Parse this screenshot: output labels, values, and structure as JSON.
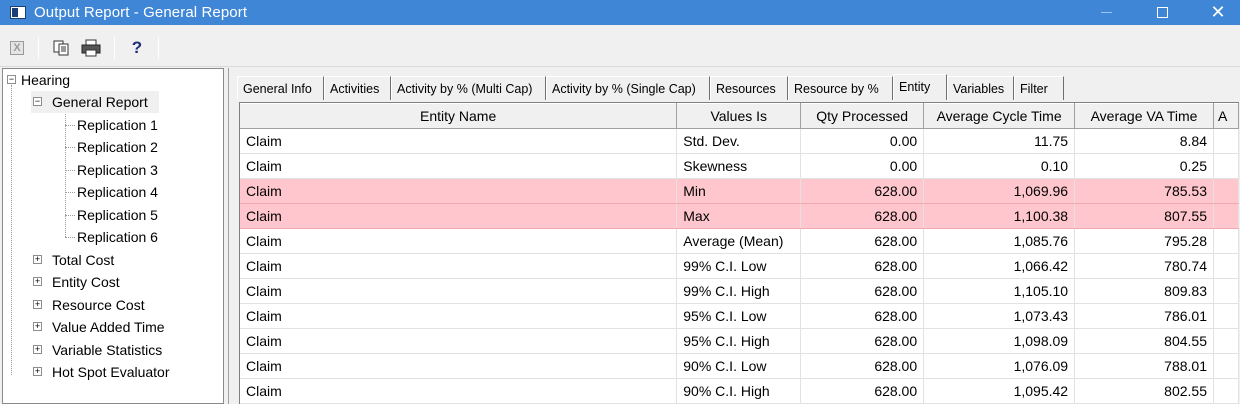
{
  "window": {
    "title": "Output Report - General Report",
    "controls": {
      "minimize": "—",
      "maximize": "☐",
      "close": "✕"
    }
  },
  "toolbar": {
    "excel_icon_text": "X",
    "copy_icon": "copy-icon",
    "print_icon": "print-icon",
    "help_label": "?"
  },
  "tree": {
    "root": "Hearing",
    "general_report": "General Report",
    "replications": [
      "Replication 1",
      "Replication 2",
      "Replication 3",
      "Replication 4",
      "Replication 5",
      "Replication 6"
    ],
    "categories": [
      "Total Cost",
      "Entity Cost",
      "Resource Cost",
      "Value Added Time",
      "Variable Statistics",
      "Hot Spot Evaluator"
    ]
  },
  "tabs": [
    {
      "label": "General Info"
    },
    {
      "label": "Activities"
    },
    {
      "label": "Activity by % (Multi Cap)"
    },
    {
      "label": "Activity by % (Single Cap)"
    },
    {
      "label": "Resources"
    },
    {
      "label": "Resource by %"
    },
    {
      "label": "Entity",
      "active": true
    },
    {
      "label": "Variables"
    },
    {
      "label": "Filter"
    }
  ],
  "grid": {
    "columns": [
      "Entity Name",
      "Values Is",
      "Qty Processed",
      "Average Cycle Time",
      "Average VA Time",
      "A"
    ],
    "rows": [
      {
        "entity": "Claim",
        "values_is": "Std. Dev.",
        "qty": "0.00",
        "cycle": "11.75",
        "va": "8.84",
        "highlight": false
      },
      {
        "entity": "Claim",
        "values_is": "Skewness",
        "qty": "0.00",
        "cycle": "0.10",
        "va": "0.25",
        "highlight": false
      },
      {
        "entity": "Claim",
        "values_is": "Min",
        "qty": "628.00",
        "cycle": "1,069.96",
        "va": "785.53",
        "highlight": true
      },
      {
        "entity": "Claim",
        "values_is": "Max",
        "qty": "628.00",
        "cycle": "1,100.38",
        "va": "807.55",
        "highlight": true
      },
      {
        "entity": "Claim",
        "values_is": "Average (Mean)",
        "qty": "628.00",
        "cycle": "1,085.76",
        "va": "795.28",
        "highlight": false
      },
      {
        "entity": "Claim",
        "values_is": "99% C.I. Low",
        "qty": "628.00",
        "cycle": "1,066.42",
        "va": "780.74",
        "highlight": false
      },
      {
        "entity": "Claim",
        "values_is": "99% C.I. High",
        "qty": "628.00",
        "cycle": "1,105.10",
        "va": "809.83",
        "highlight": false
      },
      {
        "entity": "Claim",
        "values_is": "95% C.I. Low",
        "qty": "628.00",
        "cycle": "1,073.43",
        "va": "786.01",
        "highlight": false
      },
      {
        "entity": "Claim",
        "values_is": "95% C.I. High",
        "qty": "628.00",
        "cycle": "1,098.09",
        "va": "804.55",
        "highlight": false
      },
      {
        "entity": "Claim",
        "values_is": "90% C.I. Low",
        "qty": "628.00",
        "cycle": "1,076.09",
        "va": "788.01",
        "highlight": false
      },
      {
        "entity": "Claim",
        "values_is": "90% C.I. High",
        "qty": "628.00",
        "cycle": "1,095.42",
        "va": "802.55",
        "highlight": false
      }
    ],
    "highlight_color": "#ffc6cd"
  }
}
